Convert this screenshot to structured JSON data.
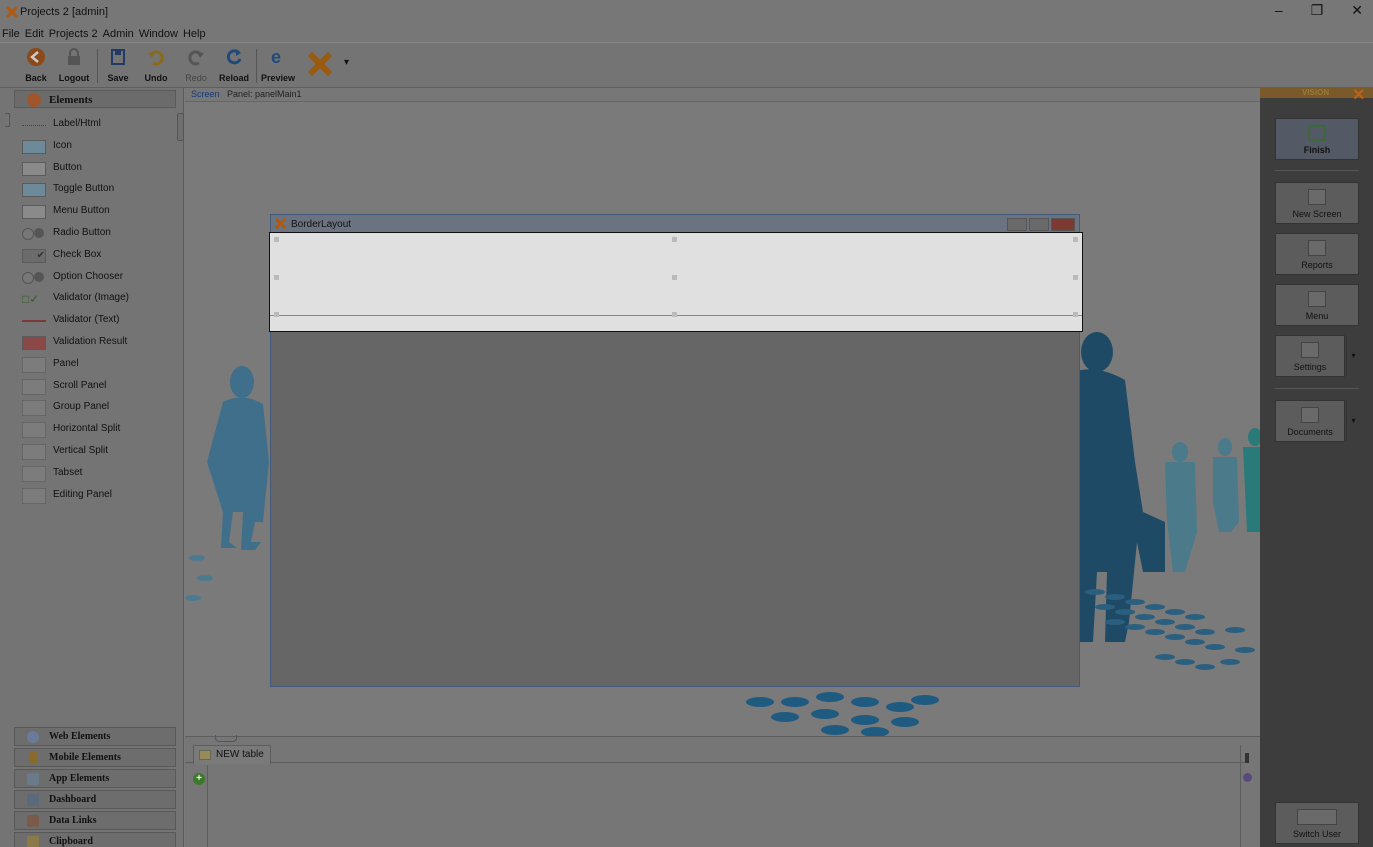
{
  "window": {
    "title": "Projects 2 [admin]",
    "controls": [
      "–",
      "❐",
      "✕"
    ]
  },
  "menu": [
    "File",
    "Edit",
    "Projects 2",
    "Admin",
    "Window",
    "Help"
  ],
  "toolbar": {
    "back": "Back",
    "logout": "Logout",
    "save": "Save",
    "undo": "Undo",
    "redo": "Redo",
    "reload": "Reload",
    "preview": "Preview",
    "dropdown_arrow": "▾"
  },
  "left_panel": {
    "header": "Elements",
    "items": [
      {
        "label": "Label/Html",
        "icon": "label-icon"
      },
      {
        "label": "Icon",
        "icon": "image-icon"
      },
      {
        "label": "Button",
        "icon": "button-icon"
      },
      {
        "label": "Toggle Button",
        "icon": "toggle-button-icon"
      },
      {
        "label": "Menu Button",
        "icon": "menu-button-icon"
      },
      {
        "label": "Radio Button",
        "icon": "radio-button-icon"
      },
      {
        "label": "Check Box",
        "icon": "checkbox-icon"
      },
      {
        "label": "Option Chooser",
        "icon": "option-chooser-icon"
      },
      {
        "label": "Validator (Image)",
        "icon": "validator-image-icon"
      },
      {
        "label": "Validator (Text)",
        "icon": "validator-text-icon"
      },
      {
        "label": "Validation Result",
        "icon": "validation-result-icon"
      },
      {
        "label": "Panel",
        "icon": "panel-icon"
      },
      {
        "label": "Scroll Panel",
        "icon": "scroll-panel-icon"
      },
      {
        "label": "Group Panel",
        "icon": "group-panel-icon"
      },
      {
        "label": "Horizontal Split",
        "icon": "horizontal-split-icon"
      },
      {
        "label": "Vertical Split",
        "icon": "vertical-split-icon"
      },
      {
        "label": "Tabset",
        "icon": "tabset-icon"
      },
      {
        "label": "Editing Panel",
        "icon": "editing-panel-icon"
      }
    ],
    "categories": [
      {
        "label": "Web Elements",
        "icon": "globe-icon"
      },
      {
        "label": "Mobile Elements",
        "icon": "mobile-icon"
      },
      {
        "label": "App Elements",
        "icon": "app-icon"
      },
      {
        "label": "Dashboard",
        "icon": "dashboard-icon"
      },
      {
        "label": "Data Links",
        "icon": "data-links-icon"
      },
      {
        "label": "Clipboard",
        "icon": "clipboard-icon"
      }
    ]
  },
  "breadcrumb": {
    "screen": "Screen",
    "panel": "Panel: panelMain1"
  },
  "dialog": {
    "title": "BorderLayout"
  },
  "bottom_panel": {
    "tab_label": "NEW table",
    "add": "+"
  },
  "right_panel": {
    "brand": "VISION",
    "finish": "Finish",
    "new_screen": "New Screen",
    "reports": "Reports",
    "menu": "Menu",
    "settings": "Settings",
    "documents": "Documents",
    "switch_user": "Switch User",
    "dropdown_arrow": "▾"
  },
  "colors": {
    "overlay_gray": "#7a7a7a",
    "silhouette_blue": "#3f6f8a",
    "silhouette_dark": "#1f4a66",
    "silhouette_teal": "#2a7a7a",
    "dialog_north": "#e0e0e0",
    "brand_orange": "#c06010"
  }
}
